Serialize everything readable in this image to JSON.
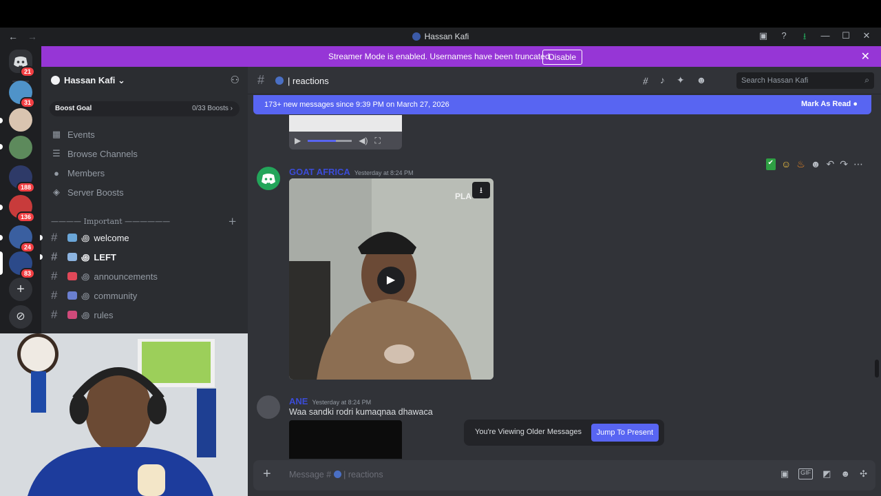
{
  "window": {
    "title": "Hassan Kafi",
    "back": "←",
    "forward": "→",
    "buttons": [
      "▣",
      "?",
      "⭳",
      "—",
      "☐",
      "✕"
    ]
  },
  "guilds": {
    "home_badge": "21",
    "badges": [
      "31",
      "188",
      "136",
      "24",
      "83"
    ],
    "add": "+",
    "discover": "⊘"
  },
  "banner": {
    "text": "Streamer Mode is enabled. Usernames have been truncated.",
    "button": "Disable",
    "close": "✕"
  },
  "server": {
    "name": "Hassan Kafi",
    "chevron": "⌄",
    "boost_label": "Boost Goal",
    "boost_count": "0/33 Boosts ›",
    "menu": [
      "Events",
      "Browse Channels",
      "Members",
      "Server Boosts"
    ],
    "category": "———— Important ——————",
    "channels": [
      {
        "name": "welcome",
        "prefix": "꩜"
      },
      {
        "name": "LEFT",
        "prefix": "꩜"
      },
      {
        "name": "announcements",
        "prefix": "꩜"
      },
      {
        "name": "community",
        "prefix": "꩜"
      },
      {
        "name": "rules",
        "prefix": "꩜"
      }
    ]
  },
  "channel": {
    "name": "| reactions",
    "search_placeholder": "Search Hassan Kafi",
    "new_messages": "173+ new messages since 9:39 PM on March 27, 2026",
    "mark_read": "Mark As Read"
  },
  "messages": [
    {
      "author": "GOAT AFRICA",
      "time": "Yesterday at 8:24 PM",
      "video_text": "PLA"
    },
    {
      "author": "ANE",
      "time": "Yesterday at 8:24 PM",
      "text": "Waa sandki rodri kumaqnaa dhawaca"
    }
  ],
  "older": {
    "text": "You're Viewing Older Messages",
    "button": "Jump To Present"
  },
  "composer": {
    "placeholder": "Message #",
    "channel": "| reactions"
  },
  "colors": {
    "accent": "#5865f2",
    "banner": "#9636d6",
    "danger": "#f23f43"
  }
}
